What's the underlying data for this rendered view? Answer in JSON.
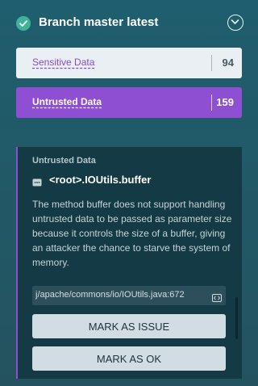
{
  "header": {
    "title": "Branch master latest",
    "status_icon": "check-circle-icon",
    "toggle_icon": "chevron-down-circle-icon"
  },
  "categories": [
    {
      "label": "Sensitive Data",
      "count": "94"
    },
    {
      "label": "Untrusted Data",
      "count": "159"
    }
  ],
  "detail": {
    "category": "Untrusted Data",
    "method_icon": "method-icon",
    "title": "<root>.IOUtils.buffer",
    "description": "The method buffer does not support handling untrusted data to be passed as parameter size because it controls the size of a buffer, giving an attacker the chance to starve the system of memory.",
    "file_path": "j/apache/commons/io/IOUtils.java:672",
    "code_icon": "code-icon",
    "mark_issue_label": "MARK AS ISSUE",
    "mark_ok_label": "MARK AS OK"
  },
  "colors": {
    "accent_purple": "#8e4fd3",
    "check_green": "#3fb39a",
    "panel_bg": "#143a46"
  }
}
